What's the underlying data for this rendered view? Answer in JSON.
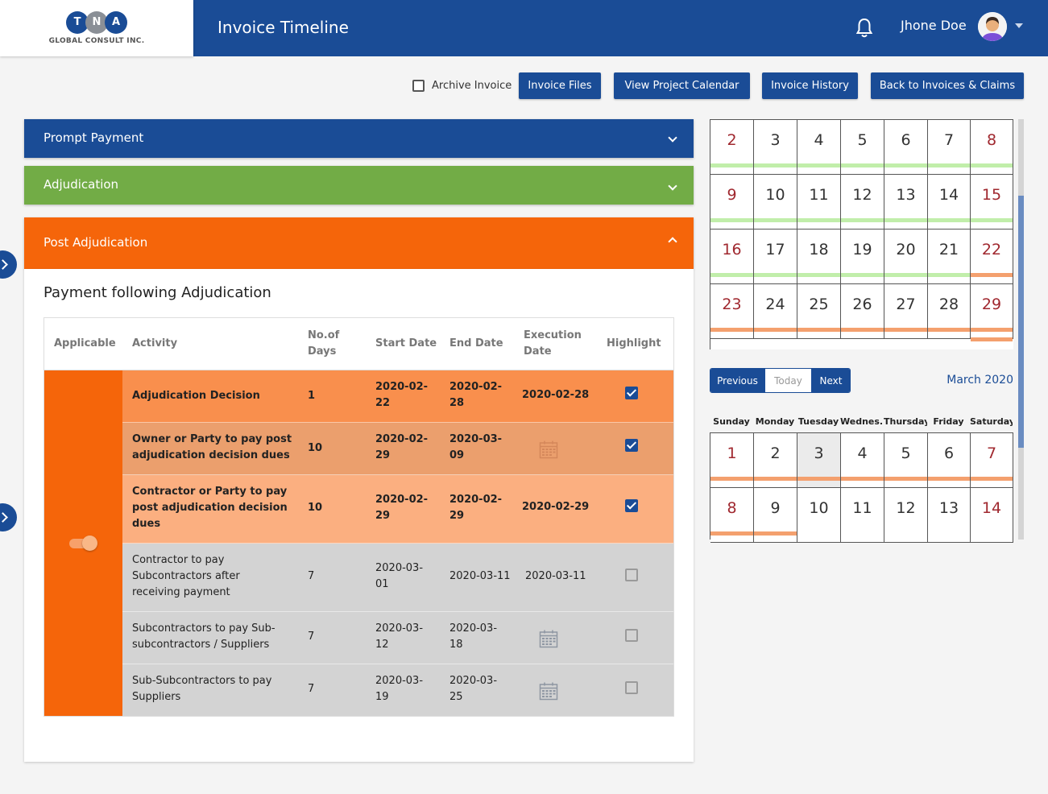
{
  "logo": {
    "letters": [
      "T",
      "N",
      "A"
    ],
    "text": "GLOBAL CONSULT INC."
  },
  "header": {
    "title": "Invoice Timeline",
    "user_name": "Jhone Doe"
  },
  "actions": {
    "archive_label": "Archive Invoice",
    "buttons": [
      "Invoice Files",
      "View Project Calendar",
      "Invoice History",
      "Back to Invoices & Claims"
    ]
  },
  "accordions": {
    "prompt_payment": "Prompt Payment",
    "adjudication": "Adjudication",
    "post_adjudication": "Post Adjudication"
  },
  "section_title": "Payment following Adjudication",
  "table": {
    "headers": {
      "applicable": "Applicable",
      "activity": "Activity",
      "days": [
        "No.of",
        "Days"
      ],
      "start": "Start Date",
      "end": "End Date",
      "execution": [
        "Execution",
        "Date"
      ],
      "highlight": "Highlight"
    },
    "rows": [
      {
        "activity": [
          "Adjudication Decision"
        ],
        "days": "1",
        "start": [
          "2020-02-",
          "22"
        ],
        "end": [
          "2020-02-",
          "28"
        ],
        "execution": "2020-02-28",
        "highlight": true
      },
      {
        "activity": [
          "Owner or Party to pay post",
          "adjudication decision dues"
        ],
        "days": "10",
        "start": [
          "2020-02-",
          "29"
        ],
        "end": [
          "2020-03-",
          "09"
        ],
        "execution": "",
        "highlight": true
      },
      {
        "activity": [
          "Contractor or Party to pay",
          "post adjudication decision",
          "dues"
        ],
        "days": "10",
        "start": [
          "2020-02-",
          "29"
        ],
        "end": [
          "2020-02-",
          "29"
        ],
        "execution": "2020-02-29",
        "highlight": true
      },
      {
        "activity": [
          "Contractor to pay",
          "Subcontractors after",
          "receiving payment"
        ],
        "days": "7",
        "start": [
          "2020-03-",
          "01"
        ],
        "end": [
          "2020-03-11"
        ],
        "execution": "2020-03-11",
        "highlight": false
      },
      {
        "activity": [
          "Subcontractors to pay Sub-",
          "subcontractors / Suppliers"
        ],
        "days": "7",
        "start": [
          "2020-03-",
          "12"
        ],
        "end": [
          "2020-03-",
          "18"
        ],
        "execution": "",
        "highlight": false
      },
      {
        "activity": [
          "Sub-Subcontractors to pay",
          "Suppliers"
        ],
        "days": "7",
        "start": [
          "2020-03-",
          "19"
        ],
        "end": [
          "2020-03-",
          "25"
        ],
        "execution": "",
        "highlight": false
      }
    ]
  },
  "february_calendar": {
    "weeks": [
      [
        2,
        3,
        4,
        5,
        6,
        7,
        8
      ],
      [
        9,
        10,
        11,
        12,
        13,
        14,
        15
      ],
      [
        16,
        17,
        18,
        19,
        20,
        21,
        22
      ],
      [
        23,
        24,
        25,
        26,
        27,
        28,
        29
      ]
    ]
  },
  "calendar_nav": {
    "previous": "Previous",
    "today": "Today",
    "next": "Next",
    "month": "March 2020"
  },
  "weekdays": [
    "Sunday",
    "Monday",
    "Tuesday",
    "Wednes...",
    "Thursday",
    "Friday",
    "Saturday"
  ],
  "march_calendar": {
    "weeks": [
      [
        1,
        2,
        3,
        4,
        5,
        6,
        7
      ],
      [
        8,
        9,
        10,
        11,
        12,
        13,
        14
      ]
    ],
    "today": 3
  },
  "colors": {
    "primary": "#1a4c96",
    "green": "#72ac46",
    "orange": "#f5650a",
    "weekend_text": "#a0282f",
    "event_green": "#c1eeaa",
    "event_orange": "#f4a06e"
  }
}
